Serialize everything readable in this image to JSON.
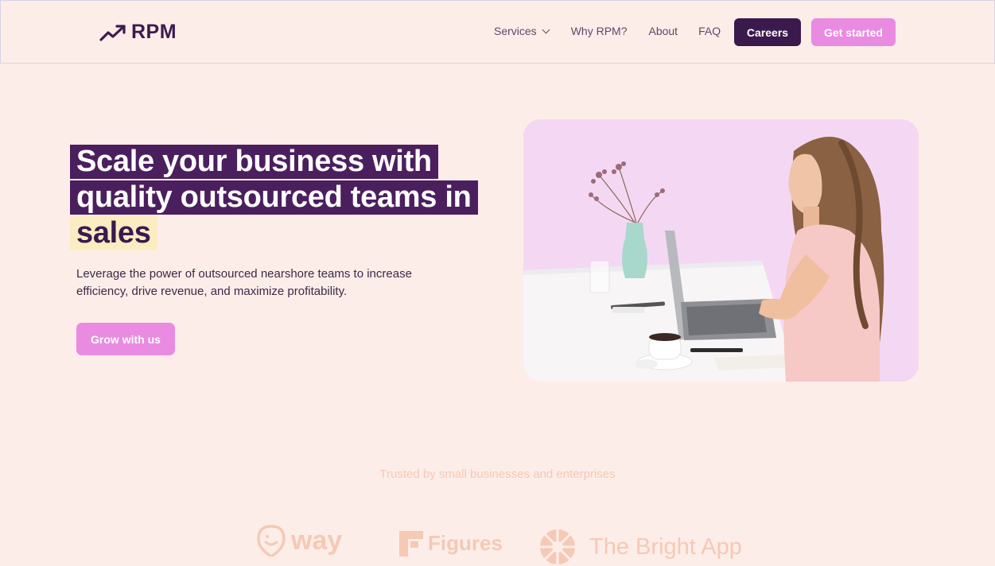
{
  "brand": {
    "name": "RPM",
    "logo_icon": "trending-up-arrow-icon"
  },
  "nav": {
    "services": "Services",
    "why": "Why RPM?",
    "about": "About",
    "faq": "FAQ",
    "careers": "Careers",
    "get_started": "Get started"
  },
  "hero": {
    "line1": "Scale your business with",
    "line2": "quality outsourced teams in",
    "highlight": "sales",
    "subtitle": "Leverage the power of outsourced nearshore teams to increase efficiency, drive revenue, and maximize profitability.",
    "cta": "Grow with us"
  },
  "trusted": {
    "heading": "Trusted by small businesses and enterprises",
    "logos": [
      "way",
      "Figures",
      "The Bright App"
    ]
  },
  "colors": {
    "background": "#fdede9",
    "primary_dark": "#3a1a4d",
    "accent_pink": "#e98be0",
    "highlight_yellow": "#fcecc2",
    "muted_peach": "#f5c9b4"
  }
}
